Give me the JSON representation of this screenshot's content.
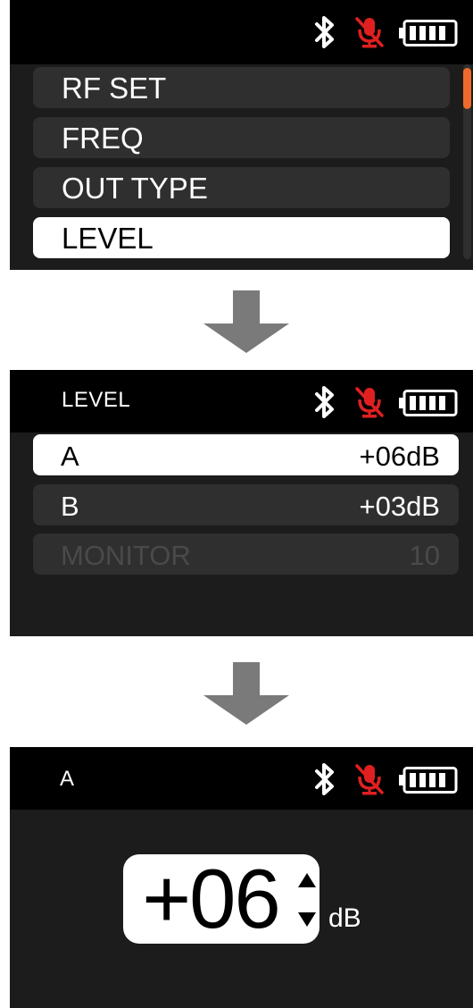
{
  "screen1": {
    "menu": [
      {
        "label": "RF SET",
        "selected": false
      },
      {
        "label": "FREQ",
        "selected": false
      },
      {
        "label": "OUT TYPE",
        "selected": false
      },
      {
        "label": "LEVEL",
        "selected": true
      }
    ]
  },
  "screen2": {
    "title": "LEVEL",
    "rows": [
      {
        "label": "A",
        "value": "+06dB",
        "state": "selected"
      },
      {
        "label": "B",
        "value": "+03dB",
        "state": "normal"
      },
      {
        "label": "MONITOR",
        "value": "10",
        "state": "disabled"
      }
    ]
  },
  "screen3": {
    "title": "A",
    "value": "+06",
    "unit": "dB"
  },
  "status_icons": [
    "bluetooth-icon",
    "mic-muted-icon",
    "battery-full-icon"
  ],
  "colors": {
    "accent": "#ee6a2c",
    "mic_muted": "#e02020",
    "selected_bg": "#ffffff",
    "item_bg": "#2f2f2f",
    "arrow": "#7a7a7a"
  }
}
